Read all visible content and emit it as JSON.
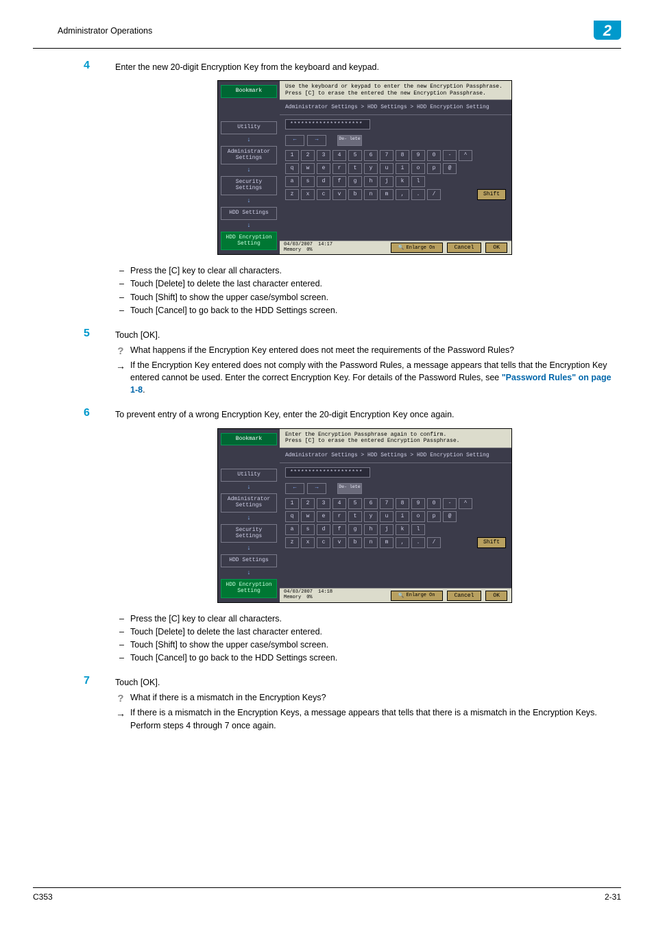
{
  "header": {
    "title": "Administrator Operations",
    "chapter": "2"
  },
  "steps": {
    "s4": {
      "num": "4",
      "text": "Enter the new 20-digit Encryption Key from the keyboard and keypad.",
      "bullets": [
        "Press the [C] key to clear all characters.",
        "Touch [Delete] to delete the last character entered.",
        "Touch [Shift] to show the upper case/symbol screen.",
        "Touch [Cancel] to go back to the HDD Settings screen."
      ]
    },
    "s5": {
      "num": "5",
      "text": "Touch [OK].",
      "q": "What happens if the Encryption Key entered does not meet the requirements of the Password Rules?",
      "a_pre": "If the Encryption Key entered does not comply with the Password Rules, a message appears that tells that the Encryption Key entered cannot be used. Enter the correct Encryption Key. For details of the Password Rules, see ",
      "a_link": "\"Password Rules\" on page 1-8",
      "a_post": "."
    },
    "s6": {
      "num": "6",
      "text": "To prevent entry of a wrong Encryption Key, enter the 20-digit Encryption Key once again.",
      "bullets": [
        "Press the [C] key to clear all characters.",
        "Touch [Delete] to delete the last character entered.",
        "Touch [Shift] to show the upper case/symbol screen.",
        "Touch [Cancel] to go back to the HDD Settings screen."
      ]
    },
    "s7": {
      "num": "7",
      "text": "Touch [OK].",
      "q": "What if there is a mismatch in the Encryption Keys?",
      "a": "If there is a mismatch in the Encryption Keys, a message appears that tells that there is a mismatch in the Encryption Keys. Perform steps 4 through 7 once again."
    }
  },
  "panel1": {
    "msg1": "Use the keyboard or keypad to enter the new Encryption Passphrase.",
    "msg2": "Press [C] to erase the entered the new Encryption Passphrase.",
    "breadcrumb": "Administrator Settings > HDD Settings > HDD Encryption Setting",
    "input": "********************",
    "date": "04/03/2007",
    "time": "14:17",
    "mem_label": "Memory",
    "mem_val": "0%"
  },
  "panel2": {
    "msg1": "Enter the Encryption Passphrase again to confirm.",
    "msg2": "Press [C] to erase the entered Encryption Passphrase.",
    "breadcrumb": "Administrator Settings > HDD Settings > HDD Encryption Setting",
    "input": "********************",
    "date": "04/03/2007",
    "time": "14:18",
    "mem_label": "Memory",
    "mem_val": "0%"
  },
  "panel_common": {
    "side": {
      "bookmark": "Bookmark",
      "utility": "Utility",
      "admin": "Administrator Settings",
      "security": "Security Settings",
      "hdd": "HDD Settings",
      "hddenc": "HDD Encryption Setting"
    },
    "delete": "De- lete",
    "shift": "Shift",
    "enlarge": "Enlarge On",
    "cancel": "Cancel",
    "ok": "OK",
    "row1": [
      "1",
      "2",
      "3",
      "4",
      "5",
      "6",
      "7",
      "8",
      "9",
      "0",
      "-",
      "^"
    ],
    "row2": [
      "q",
      "w",
      "e",
      "r",
      "t",
      "y",
      "u",
      "i",
      "o",
      "p",
      "@"
    ],
    "row3": [
      "a",
      "s",
      "d",
      "f",
      "g",
      "h",
      "j",
      "k",
      "l"
    ],
    "row4": [
      "z",
      "x",
      "c",
      "v",
      "b",
      "n",
      "m",
      ",",
      ".",
      "/"
    ]
  },
  "footer": {
    "left": "C353",
    "right": "2-31"
  }
}
